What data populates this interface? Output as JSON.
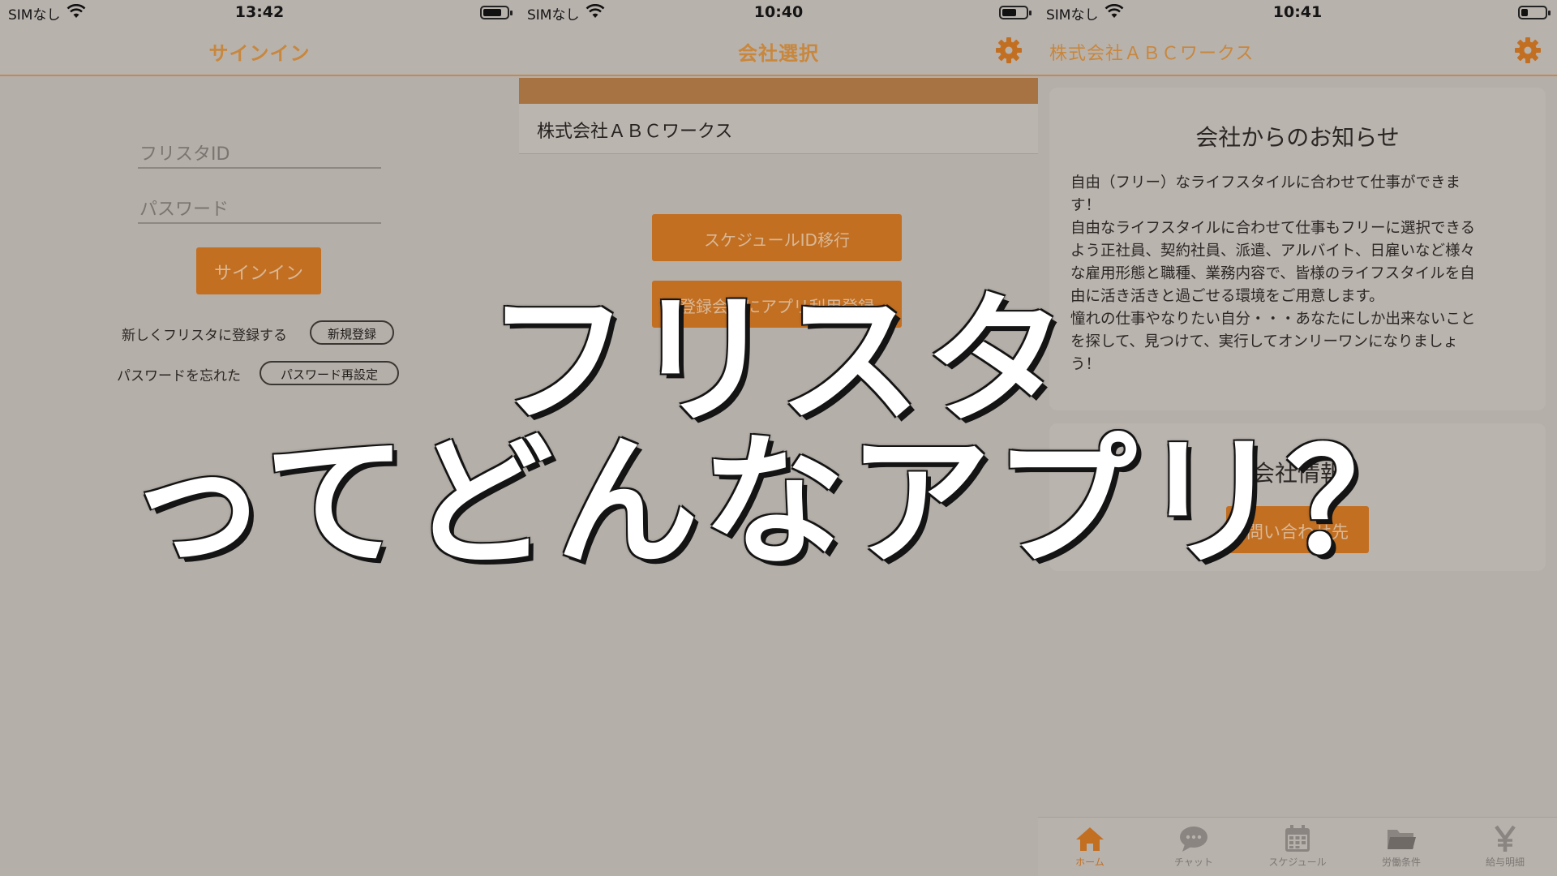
{
  "colors": {
    "accent": "#c26f22",
    "title_orange": "#c8873c",
    "background": "#b5afa9",
    "overlay_text": "#ffffff"
  },
  "status_bars": [
    {
      "carrier": "SIMなし",
      "time": "13:42"
    },
    {
      "carrier": "SIMなし",
      "time": "10:40"
    },
    {
      "carrier": "SIMなし",
      "time": "10:41"
    }
  ],
  "battery_levels": [
    0.8,
    0.6,
    0.3
  ],
  "signin": {
    "title": "サインイン",
    "id_placeholder": "フリスタID",
    "password_placeholder": "パスワード",
    "signin_button": "サインイン",
    "register_prompt": "新しくフリスタに登録する",
    "register_button": "新規登録",
    "forgot_prompt": "パスワードを忘れた",
    "reset_button": "パスワード再設定"
  },
  "company_select": {
    "title": "会社選択",
    "settings_icon": "gear-icon",
    "companies": [
      "株式会社ＡＢＣワークス"
    ],
    "schedule_transfer_button": "スケジュールID移行",
    "register_app_button": "登録会社にアプリ利用登録"
  },
  "home": {
    "title": "株式会社ＡＢＣワークス",
    "settings_icon": "gear-icon",
    "notice_title": "会社からのお知らせ",
    "notice_lines": [
      "自由（フリー）なライフスタイルに合わせて仕事ができま",
      "す！",
      "自由なライフスタイルに合わせて仕事もフリーに選択できる",
      "よう正社員、契約社員、派遣、アルバイト、日雇いなど様々",
      "な雇用形態と職種、業務内容で、皆様のライフスタイルを自",
      "由に活き活きと過ごせる環境をご用意します。",
      "憧れの仕事やなりたい自分・・・あなたにしか出来ないこと",
      "を探して、見つけて、実行してオンリーワンになりましょ",
      "う！"
    ],
    "info_title": "会社情報",
    "contact_button": "問い合わせ先",
    "tabs": [
      {
        "label": "ホーム",
        "icon": "home-icon"
      },
      {
        "label": "チャット",
        "icon": "chat-icon"
      },
      {
        "label": "スケジュール",
        "icon": "calendar-icon"
      },
      {
        "label": "労働条件",
        "icon": "folder-icon"
      },
      {
        "label": "給与明細",
        "icon": "yen-icon"
      }
    ]
  },
  "overlay": {
    "line1": "フリスタ",
    "line2": "ってどんなアプリ？"
  }
}
